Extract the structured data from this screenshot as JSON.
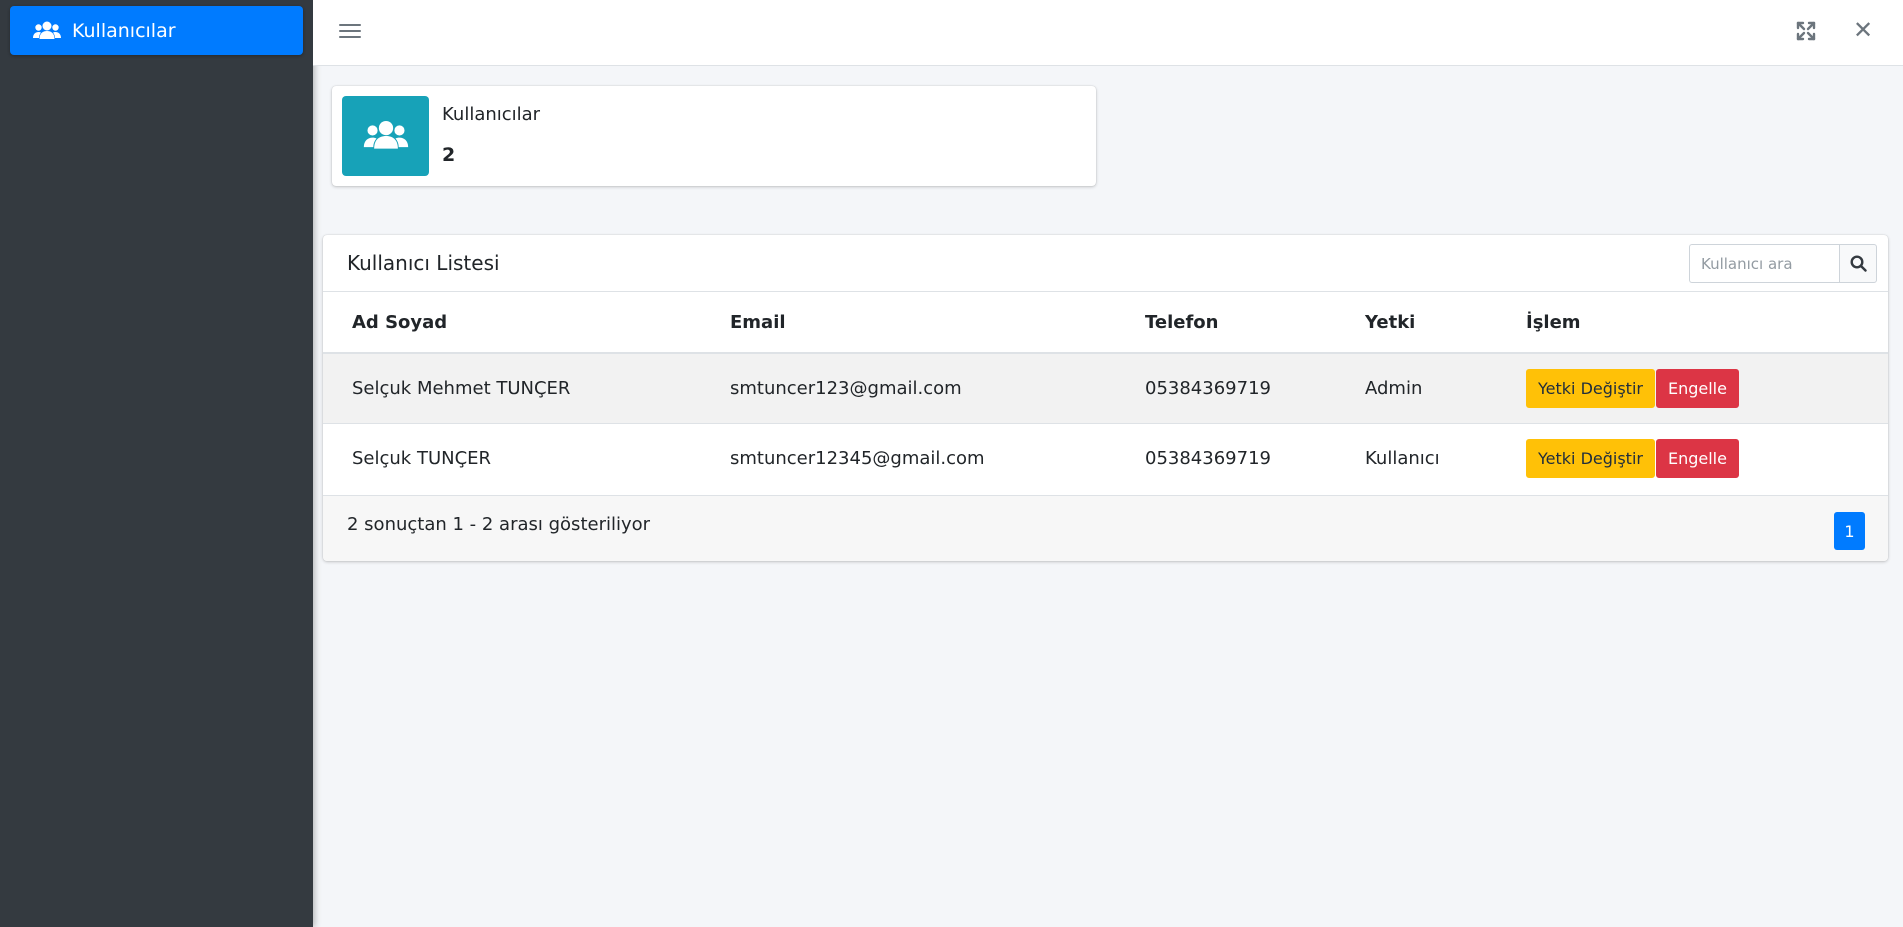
{
  "sidebar": {
    "items": [
      {
        "label": "Kullanıcılar",
        "icon": "users-icon"
      }
    ]
  },
  "topbar": {
    "menu_icon": "bars-icon",
    "expand_icon": "expand-icon",
    "close_icon": "close-icon",
    "close_glyph": "✕"
  },
  "info_box": {
    "label": "Kullanıcılar",
    "count": "2",
    "icon": "users-icon",
    "color": "#17a2b8"
  },
  "user_list": {
    "title": "Kullanıcı Listesi",
    "search": {
      "placeholder": "Kullanıcı ara",
      "value": ""
    },
    "columns": [
      "Ad Soyad",
      "Email",
      "Telefon",
      "Yetki",
      "İşlem"
    ],
    "rows": [
      {
        "name": "Selçuk Mehmet TUNÇER",
        "email": "smtuncer123@gmail.com",
        "phone": "05384369719",
        "role": "Admin",
        "change_role_label": "Yetki Değiştir",
        "block_label": "Engelle"
      },
      {
        "name": "Selçuk TUNÇER",
        "email": "smtuncer12345@gmail.com",
        "phone": "05384369719",
        "role": "Kullanıcı",
        "change_role_label": "Yetki Değiştir",
        "block_label": "Engelle"
      }
    ],
    "footer_text": "2 sonuçtan 1 - 2 arası gösteriliyor",
    "pagination": {
      "current_page": "1"
    }
  },
  "colors": {
    "primary": "#007bff",
    "sidebar_bg": "#343a40",
    "warning": "#ffc107",
    "danger": "#dc3545",
    "info": "#17a2b8"
  }
}
